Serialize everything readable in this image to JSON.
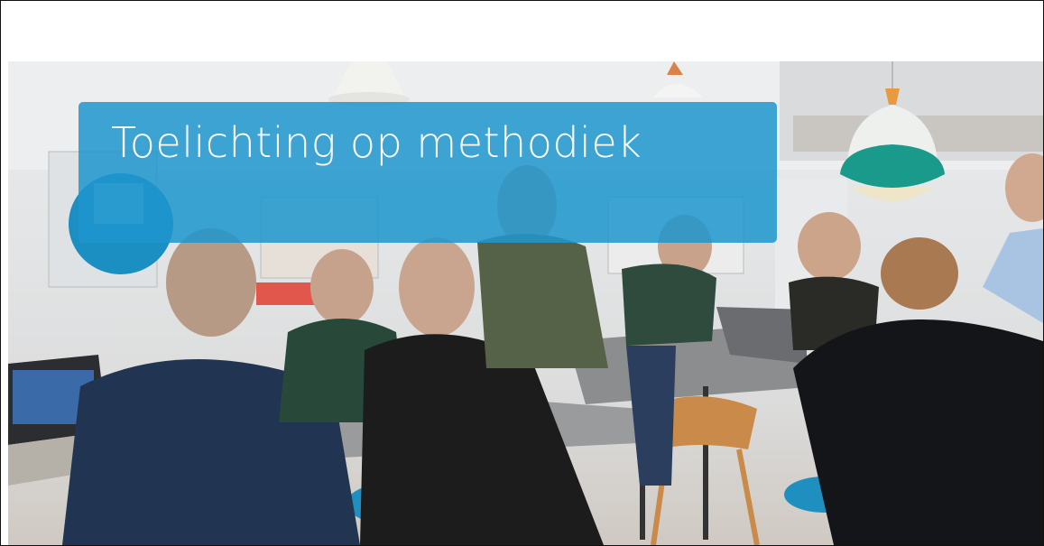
{
  "slide": {
    "title": "Toelichting op methodiek"
  },
  "photo": {
    "alt_subject": "team-working-at-standing-tables",
    "accent_color": "#1e96cd"
  }
}
